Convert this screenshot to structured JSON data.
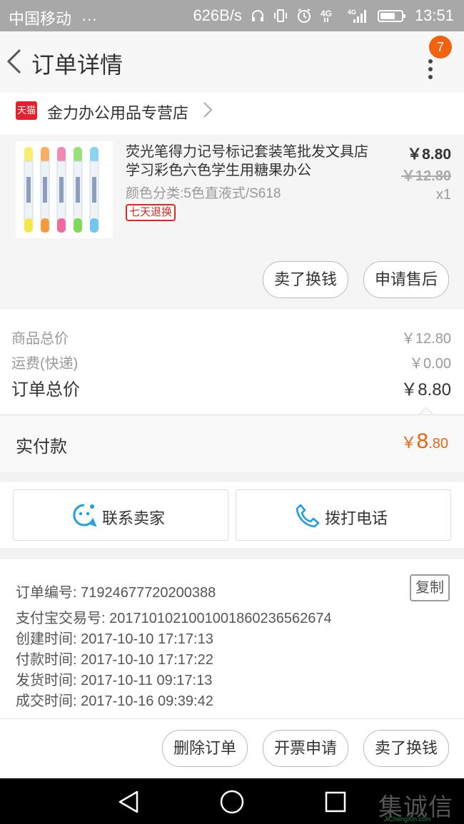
{
  "status_bar": {
    "carrier": "中国移动",
    "carrier_extra": "···",
    "net_speed": "626B/s",
    "time": "13:51"
  },
  "header": {
    "title": "订单详情",
    "badge_count": "7"
  },
  "store": {
    "platform_label": "天猫",
    "name": "金力办公用品专营店"
  },
  "product": {
    "name": "荧光笔得力记号标记套装笔批发文具店学习彩色六色学生用糖果办公",
    "attributes": "颜色分类:5色直液式/S618",
    "tag": "七天退换",
    "price": "￥8.80",
    "original_price": "￥12.80",
    "quantity": "x1",
    "pen_colors": [
      "#f5e84a",
      "#f79a3c",
      "#f06aa0",
      "#7ed957",
      "#6fc7ee"
    ]
  },
  "product_actions": {
    "sell_label": "卖了换钱",
    "aftersale_label": "申请售后"
  },
  "summary": {
    "goods_total_label": "商品总价",
    "goods_total_value": "￥12.80",
    "shipping_label": "运费(快递)",
    "shipping_value": "￥0.00",
    "order_total_label": "订单总价",
    "order_total_value": "￥8.80",
    "paid_label": "实付款",
    "paid_currency": "￥",
    "paid_int": "8",
    "paid_dec": ".80"
  },
  "contact": {
    "seller_label": "联系卖家",
    "phone_label": "拨打电话"
  },
  "order_info": {
    "order_no_label": "订单编号:",
    "order_no": "71924677720200388",
    "copy_label": "复制",
    "alipay_no_label": "支付宝交易号:",
    "alipay_no": "2017101021001001860236562674",
    "created_label": "创建时间:",
    "created": "2017-10-10 17:17:13",
    "paid_time_label": "付款时间:",
    "paid_time": "2017-10-10 17:17:22",
    "shipped_label": "发货时间:",
    "shipped": "2017-10-11 09:17:13",
    "completed_label": "成交时间:",
    "completed": "2017-10-16 09:39:42"
  },
  "bottom_actions": {
    "delete_label": "删除订单",
    "invoice_label": "开票申请",
    "sell_label": "卖了换钱"
  },
  "watermark": {
    "text": "集诚信",
    "sub": "JiChengXin.com"
  },
  "colors": {
    "accent": "#f0620f",
    "tmall_red": "#e4222d",
    "icon_blue": "#1e9fe0"
  }
}
